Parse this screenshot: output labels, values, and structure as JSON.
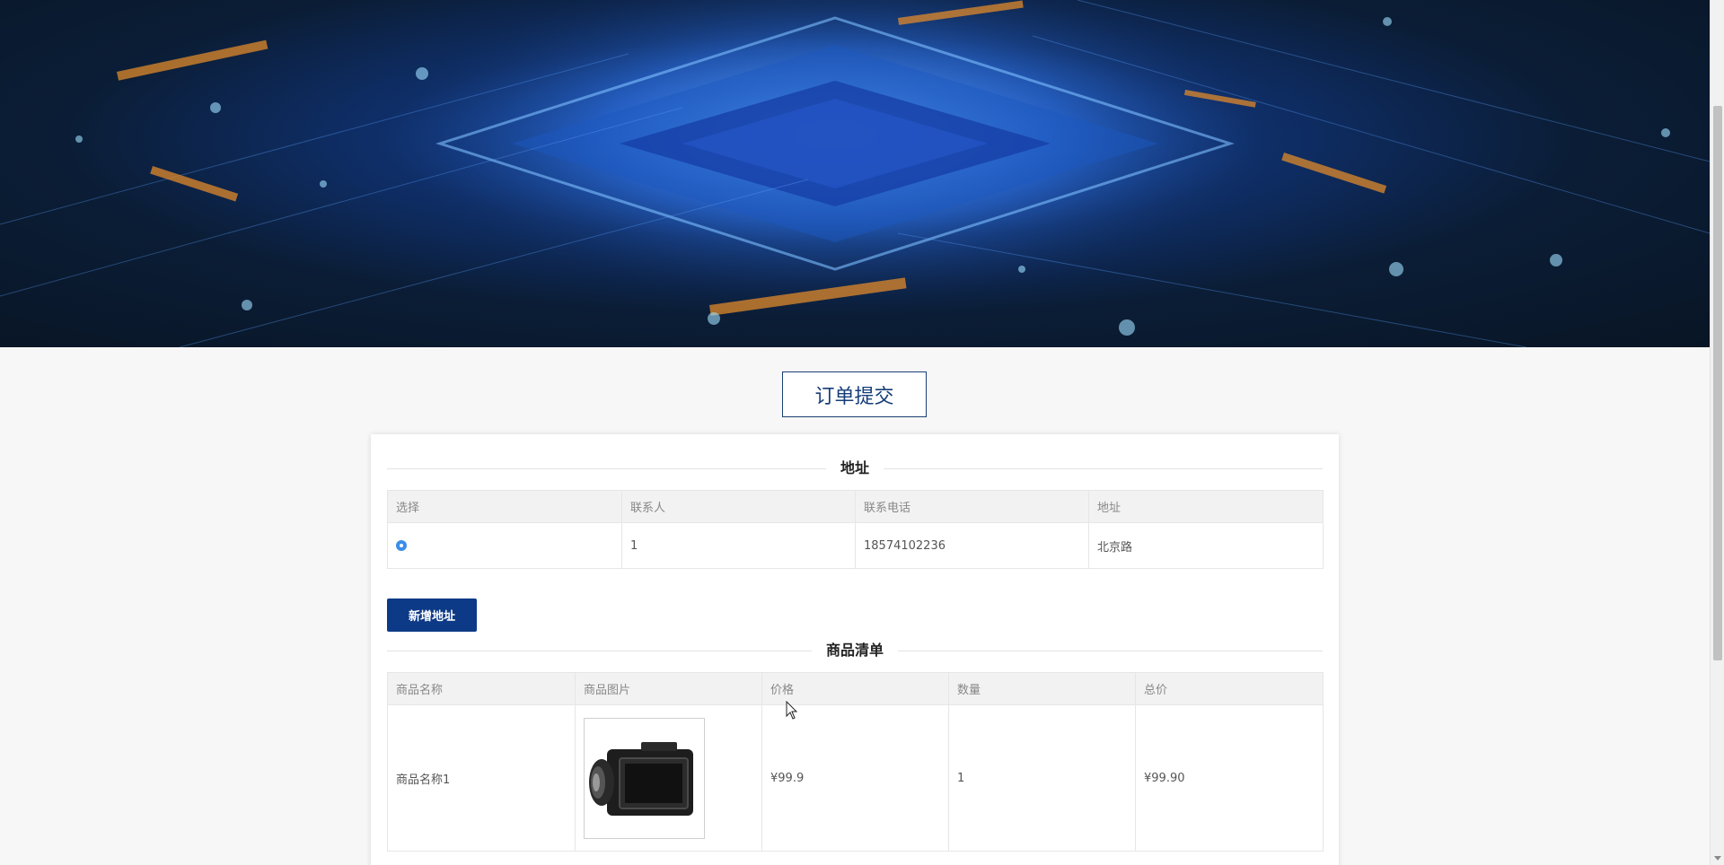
{
  "title": "订单提交",
  "address_section": {
    "heading": "地址",
    "columns": [
      "选择",
      "联系人",
      "联系电话",
      "地址"
    ],
    "rows": [
      {
        "selected": true,
        "contact": "1",
        "phone": "18574102236",
        "address": "北京路"
      }
    ],
    "add_button": "新增地址"
  },
  "goods_section": {
    "heading": "商品清单",
    "columns": [
      "商品名称",
      "商品图片",
      "价格",
      "数量",
      "总价"
    ],
    "rows": [
      {
        "name": "商品名称1",
        "image": "camcorder-image",
        "price": "¥99.9",
        "quantity": "1",
        "total": "¥99.90"
      }
    ]
  },
  "colors": {
    "accent": "#0d3a86",
    "title_text": "#163d78",
    "radio": "#3b8ee8"
  },
  "icons": {
    "radio": "radio-selected-icon",
    "cursor": "mouse-pointer-icon"
  }
}
